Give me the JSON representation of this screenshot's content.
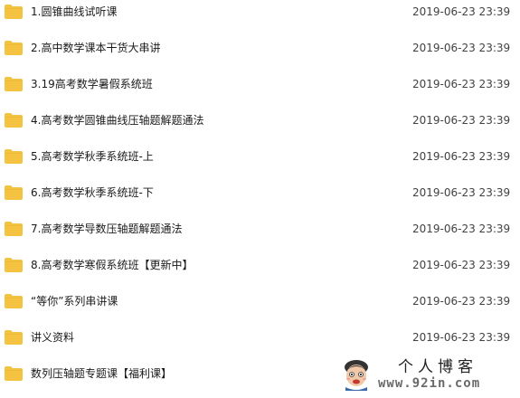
{
  "files": [
    {
      "name": "1.圆锥曲线试听课",
      "date": "2019-06-23 23:39",
      "icon": "folder-icon"
    },
    {
      "name": "2.高中数学课本干货大串讲",
      "date": "2019-06-23 23:39",
      "icon": "folder-icon"
    },
    {
      "name": "3.19高考数学暑假系统班",
      "date": "2019-06-23 23:39",
      "icon": "folder-icon"
    },
    {
      "name": "4.高考数学圆锥曲线压轴题解题通法",
      "date": "2019-06-23 23:39",
      "icon": "folder-icon"
    },
    {
      "name": "5.高考数学秋季系统班-上",
      "date": "2019-06-23 23:39",
      "icon": "folder-icon"
    },
    {
      "name": "6.高考数学秋季系统班-下",
      "date": "2019-06-23 23:39",
      "icon": "folder-icon"
    },
    {
      "name": "7.高考数学导数压轴题解题通法",
      "date": "2019-06-23 23:39",
      "icon": "folder-icon"
    },
    {
      "name": "8.高考数学寒假系统班【更新中】",
      "date": "2019-06-23 23:39",
      "icon": "folder-icon"
    },
    {
      "name": "“等你”系列串讲课",
      "date": "2019-06-23 23:39",
      "icon": "folder-icon"
    },
    {
      "name": "讲义资料",
      "date": "2019-06-23 23:39",
      "icon": "folder-icon"
    },
    {
      "name": "数列压轴题专题课【福利课】",
      "date": "",
      "icon": "folder-icon"
    }
  ],
  "watermark": {
    "title": "个人博客",
    "url": "www.92in.com"
  },
  "colors": {
    "folder": "#f5c342",
    "folder_tab": "#e9ae2a",
    "text": "#1a1a1a",
    "date_text": "#424242"
  }
}
